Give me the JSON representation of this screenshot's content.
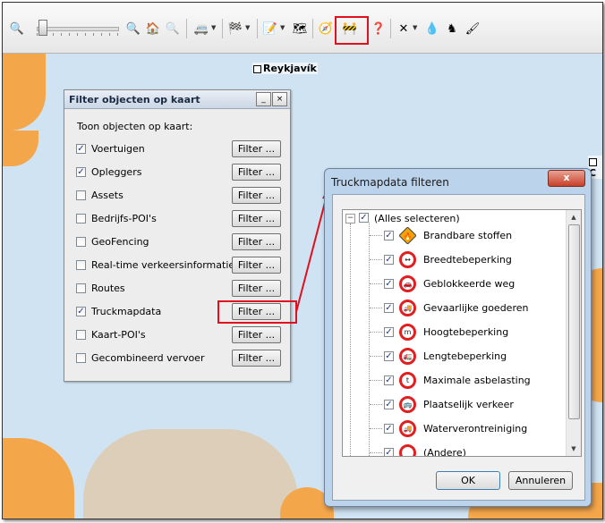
{
  "map": {
    "city_reykjavik": "Reykjavík",
    "city_partial": "C"
  },
  "filter_panel": {
    "title": "Filter objecten op kaart",
    "subtitle": "Toon objecten op kaart:",
    "minimize_label": "_",
    "close_label": "×",
    "filter_label": "Filter ...",
    "rows": [
      {
        "label": "Voertuigen",
        "checked": true
      },
      {
        "label": "Opleggers",
        "checked": true
      },
      {
        "label": "Assets",
        "checked": false
      },
      {
        "label": "Bedrijfs-POI's",
        "checked": false
      },
      {
        "label": "GeoFencing",
        "checked": false
      },
      {
        "label": "Real-time verkeersinformatie",
        "checked": false
      },
      {
        "label": "Routes",
        "checked": false
      },
      {
        "label": "Truckmapdata",
        "checked": true
      },
      {
        "label": "Kaart-POI's",
        "checked": false
      },
      {
        "label": "Gecombineerd vervoer",
        "checked": false
      }
    ]
  },
  "dialog": {
    "title": "Truckmapdata filteren",
    "close_label": "x",
    "tree_root": {
      "label": "(Alles selecteren)",
      "checked": true,
      "expander": "−"
    },
    "items": [
      {
        "label": "Brandbare stoffen",
        "checked": true,
        "icon": "flammable-icon",
        "glyph": "🔥"
      },
      {
        "label": "Breedtebeperking",
        "checked": true,
        "icon": "width-restriction-icon",
        "glyph": "↔"
      },
      {
        "label": "Geblokkeerde weg",
        "checked": true,
        "icon": "blocked-road-icon",
        "glyph": "🚗"
      },
      {
        "label": "Gevaarlijke goederen",
        "checked": true,
        "icon": "dangerous-goods-icon",
        "glyph": "🚚"
      },
      {
        "label": "Hoogtebeperking",
        "checked": true,
        "icon": "height-restriction-icon",
        "glyph": "m"
      },
      {
        "label": "Lengtebeperking",
        "checked": true,
        "icon": "length-restriction-icon",
        "glyph": "🚛"
      },
      {
        "label": "Maximale asbelasting",
        "checked": true,
        "icon": "axle-load-icon",
        "glyph": "t"
      },
      {
        "label": "Plaatselijk verkeer",
        "checked": true,
        "icon": "local-traffic-icon",
        "glyph": "🚌"
      },
      {
        "label": "Waterverontreiniging",
        "checked": true,
        "icon": "water-pollution-icon",
        "glyph": "🚚"
      },
      {
        "label": "(Andere)",
        "checked": true,
        "icon": "other-icon",
        "glyph": ""
      }
    ],
    "ok_label": "OK",
    "cancel_label": "Annuleren"
  },
  "colors": {
    "highlight": "#e0101e",
    "land": "#f4a64b",
    "sea": "#cfe3f3"
  }
}
